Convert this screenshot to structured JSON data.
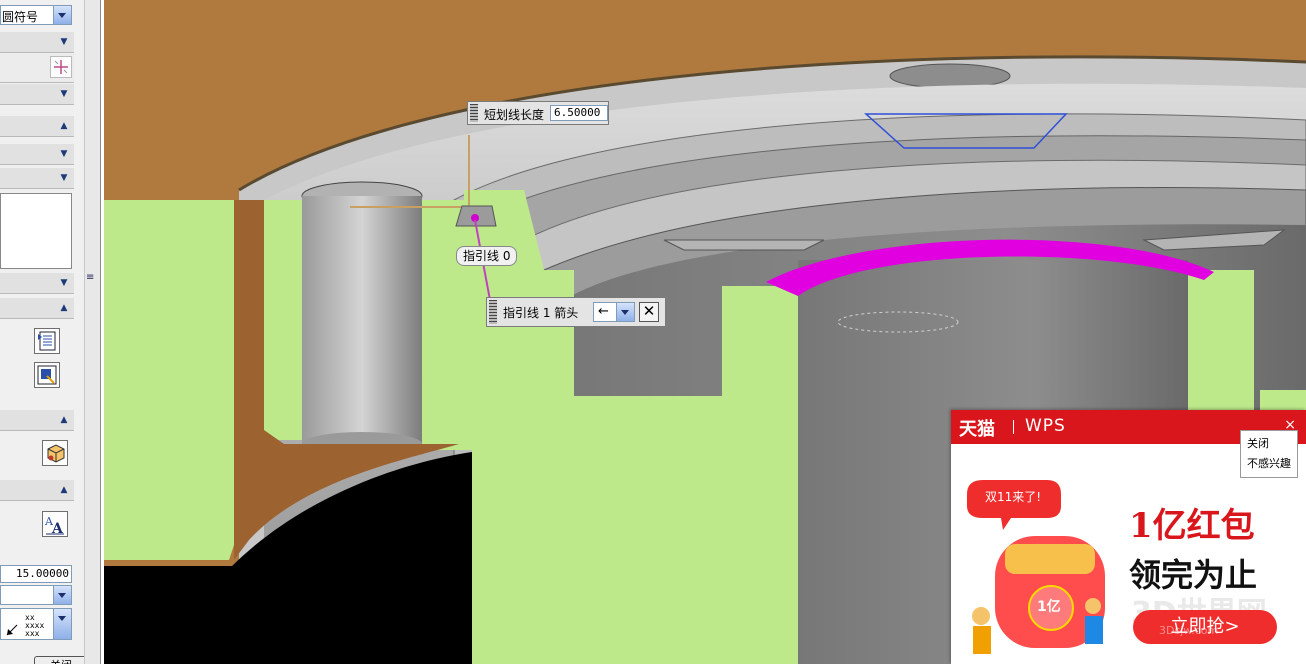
{
  "left_panel": {
    "top_combo_text": "圆符号",
    "value_field": "15.00000",
    "bottom_button_text": "关闭"
  },
  "viewport": {
    "dash_length_label": "短划线长度",
    "dash_length_value": "6.50000",
    "leader_zero_label": "指引线 0",
    "leader_one_label": "指引线 1  箭头",
    "arrow_option": "←"
  },
  "ad": {
    "brand_left": "天猫",
    "brand_right": "WPS",
    "close_glyph": "×",
    "menu_close": "关闭",
    "menu_not_interested": "不感兴趣",
    "bubble": "双11来了!",
    "headline": "1亿红包",
    "subline": "领完为止",
    "button": "立即抢>",
    "envelope_text": "1亿",
    "watermark": "3D世界网",
    "watermark_url": "3Dsjw.com"
  },
  "colors": {
    "model_green": "#bde98b",
    "model_brown": "#b07a3e",
    "highlight_magenta": "#e000e0",
    "ad_red": "#d9161c"
  }
}
